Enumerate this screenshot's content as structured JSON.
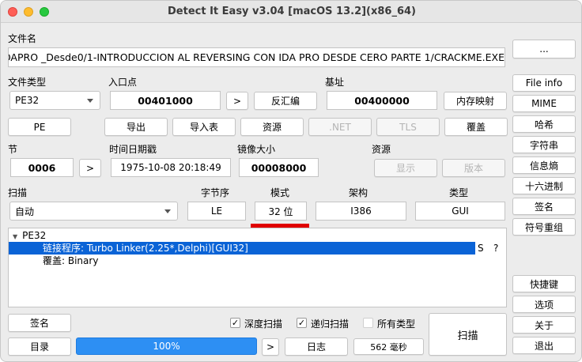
{
  "window": {
    "title": "Detect It Easy v3.04 [macOS 13.2](x86_64)"
  },
  "file": {
    "label": "文件名",
    "path": "OAPRO _Desde0/1-INTRODUCCION AL REVERSING CON IDA PRO DESDE CERO PARTE 1/CRACKME.EXE",
    "browse_label": "..."
  },
  "filetype": {
    "label": "文件类型",
    "value": "PE32"
  },
  "entrypoint": {
    "label": "入口点",
    "value": "00401000",
    "next_label": ">",
    "disasm_label": "反汇编"
  },
  "base": {
    "label": "基址",
    "value": "00400000",
    "memmap_label": "内存映射"
  },
  "actions": {
    "pe": "PE",
    "export": "导出",
    "import": "导入表",
    "resources": "资源",
    "net": ".NET",
    "tls": "TLS",
    "overlay": "覆盖"
  },
  "sections": {
    "label": "节",
    "value": "0006",
    "next_label": ">"
  },
  "timestamp": {
    "label": "时间日期戳",
    "value": "1975-10-08 20:18:49"
  },
  "image_size": {
    "label": "镜像大小",
    "value": "00008000"
  },
  "res_panel": {
    "label": "资源",
    "show_label": "显示",
    "version_label": "版本"
  },
  "scan": {
    "label": "扫描",
    "mode": "自动"
  },
  "info": {
    "endian_label": "字节序",
    "endian": "LE",
    "mode_label": "模式",
    "mode": "32 位",
    "arch_label": "架构",
    "arch": "I386",
    "type_label": "类型",
    "type": "GUI"
  },
  "results": {
    "root": "PE32",
    "items": [
      {
        "text": "链接程序: Turbo Linker(2.25*,Delphi)[GUI32]",
        "flag1": "S",
        "flag2": "?"
      },
      {
        "text": "覆盖: Binary"
      }
    ]
  },
  "side_buttons": [
    "File info",
    "MIME",
    "哈希",
    "字符串",
    "信息熵",
    "十六进制",
    "签名",
    "符号重组"
  ],
  "side_bottom": [
    "快捷键",
    "选项",
    "关于",
    "退出"
  ],
  "bottom": {
    "signatures": "签名",
    "directory": "目录",
    "progress": "100%",
    "progress_value": 1.0,
    "next_label": ">",
    "log": "日志",
    "time": "562 毫秒",
    "deep_scan": "深度扫描",
    "recursive_scan": "递归扫描",
    "all_types": "所有类型",
    "scan_button": "扫描"
  },
  "colors": {
    "selection": "#0a63d6",
    "progress": "#2d8ff3",
    "highlight": "#e00000"
  }
}
